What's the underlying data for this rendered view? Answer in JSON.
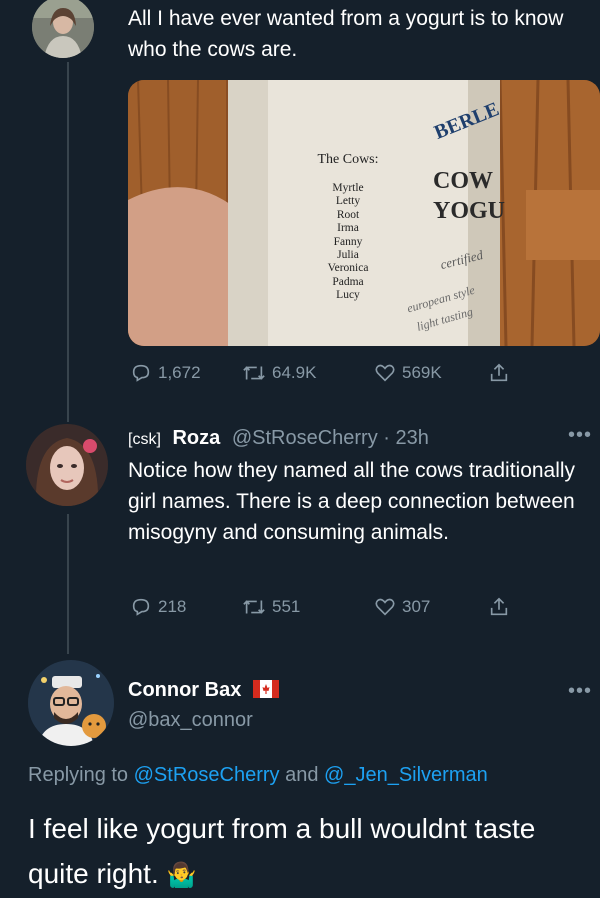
{
  "tweet1": {
    "text": "All I have ever wanted from a yogurt is to know who the cows are.",
    "media": {
      "label_heading": "The Cows:",
      "cow_names": [
        "Myrtle",
        "Letty",
        "Root",
        "Irma",
        "Fanny",
        "Julia",
        "Veronica",
        "Padma",
        "Lucy"
      ],
      "brand_top": "BERLE",
      "brand_mid": "COW",
      "brand_low": "YOGU",
      "side_text_1": "certified",
      "side_text_2": "european style",
      "side_text_3": "light tasting"
    },
    "stats": {
      "replies": "1,672",
      "retweets": "64.9K",
      "likes": "569K"
    }
  },
  "tweet2": {
    "name_prefix": "[csk]",
    "name": "Roza",
    "handle": "@StRoseCherry",
    "separator": "·",
    "time": "23h",
    "text": "Notice how they named all the cows traditionally girl names. There is a deep connection between misogyny and consuming animals.",
    "stats": {
      "replies": "218",
      "retweets": "551",
      "likes": "307"
    }
  },
  "tweet3": {
    "name": "Connor Bax",
    "handle": "@bax_connor",
    "replying_prefix": "Replying to",
    "replying_handle_1": "@StRoseCherry",
    "replying_and": "and",
    "replying_handle_2": "@_Jen_Silverman",
    "text": "I feel like yogurt from a bull wouldnt taste quite right.",
    "emoji": "🤷‍♂️"
  },
  "icons": {
    "reply": "reply-icon",
    "retweet": "retweet-icon",
    "like": "heart-icon",
    "share": "share-icon",
    "more": "more-icon",
    "flag": "canada-flag-icon"
  },
  "colors": {
    "background": "#15202b",
    "muted": "#8899a6",
    "link": "#1da1f2",
    "divider": "#38444d"
  }
}
